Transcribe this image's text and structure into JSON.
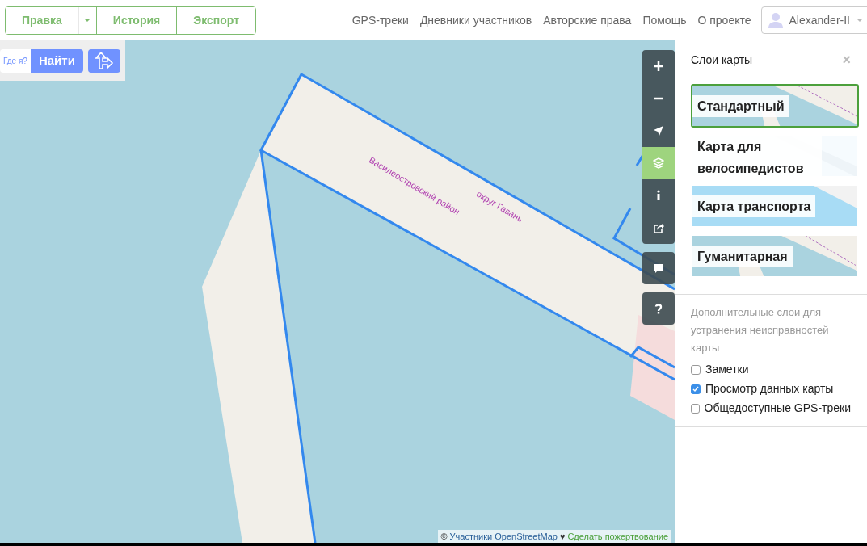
{
  "header": {
    "edit_group": [
      {
        "kind": "text",
        "label": "Правка"
      },
      {
        "kind": "caret"
      },
      {
        "kind": "text",
        "label": "История"
      },
      {
        "kind": "text",
        "label": "Экспорт"
      }
    ],
    "links": [
      "GPS-треки",
      "Дневники участников",
      "Авторские права",
      "Помощь",
      "О проекте"
    ],
    "user": {
      "name": "Alexander-II"
    }
  },
  "search": {
    "where_am_i": "Где я?",
    "button": "Найти"
  },
  "map": {
    "labels": [
      "Василеостровский район",
      "округ Гавань"
    ],
    "controls": [
      {
        "kind": "zoom-in",
        "selected": false
      },
      {
        "kind": "zoom-out",
        "selected": false
      },
      {
        "kind": "locate",
        "selected": false
      },
      {
        "kind": "layers",
        "selected": true
      },
      {
        "kind": "info",
        "selected": false
      },
      {
        "kind": "share",
        "selected": false
      },
      {
        "kind": "note",
        "selected": false
      },
      {
        "kind": "help",
        "selected": false
      }
    ],
    "attribution": {
      "symbol": "©",
      "contributors": "Участники OpenStreetMap",
      "heart": "♥",
      "donate": "Сделать пожертвование"
    }
  },
  "sidebar": {
    "title": "Слои карты",
    "close": "×",
    "layers": [
      {
        "label": "Стандартный",
        "kind": "standard",
        "selected": true
      },
      {
        "label": "Карта для велосипедистов",
        "kind": "cycle",
        "selected": false
      },
      {
        "label": "Карта транспорта",
        "kind": "transport",
        "selected": false
      },
      {
        "label": "Гуманитарная",
        "kind": "humanitarian",
        "selected": false
      }
    ],
    "overlays_note": "Дополнительные слои для устранения неисправностей карты",
    "overlays": [
      {
        "label": "Заметки",
        "checked": false
      },
      {
        "label": "Просмотр данных карты",
        "checked": true
      },
      {
        "label": "Общедоступные GPS-треки",
        "checked": false
      }
    ]
  }
}
